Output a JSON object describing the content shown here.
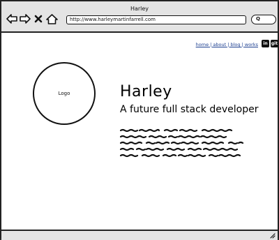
{
  "window": {
    "title": "Harley",
    "url": "http://www.harleymartinfarrell.com",
    "search_symbol": "Q"
  },
  "toolbar": {
    "icons": [
      "back-arrow-icon",
      "forward-arrow-icon",
      "close-x-icon",
      "home-icon"
    ]
  },
  "nav": {
    "links": [
      "home",
      "about",
      "blog",
      "works"
    ],
    "separator": " | "
  },
  "social": {
    "linkedin": "in",
    "github": "git"
  },
  "hero": {
    "logo_label": "Logo",
    "name": "Harley",
    "tagline": "A future full stack developer"
  },
  "colors": {
    "link": "#1a3d8f",
    "chrome": "#e4e4e4",
    "ink": "#111111"
  }
}
